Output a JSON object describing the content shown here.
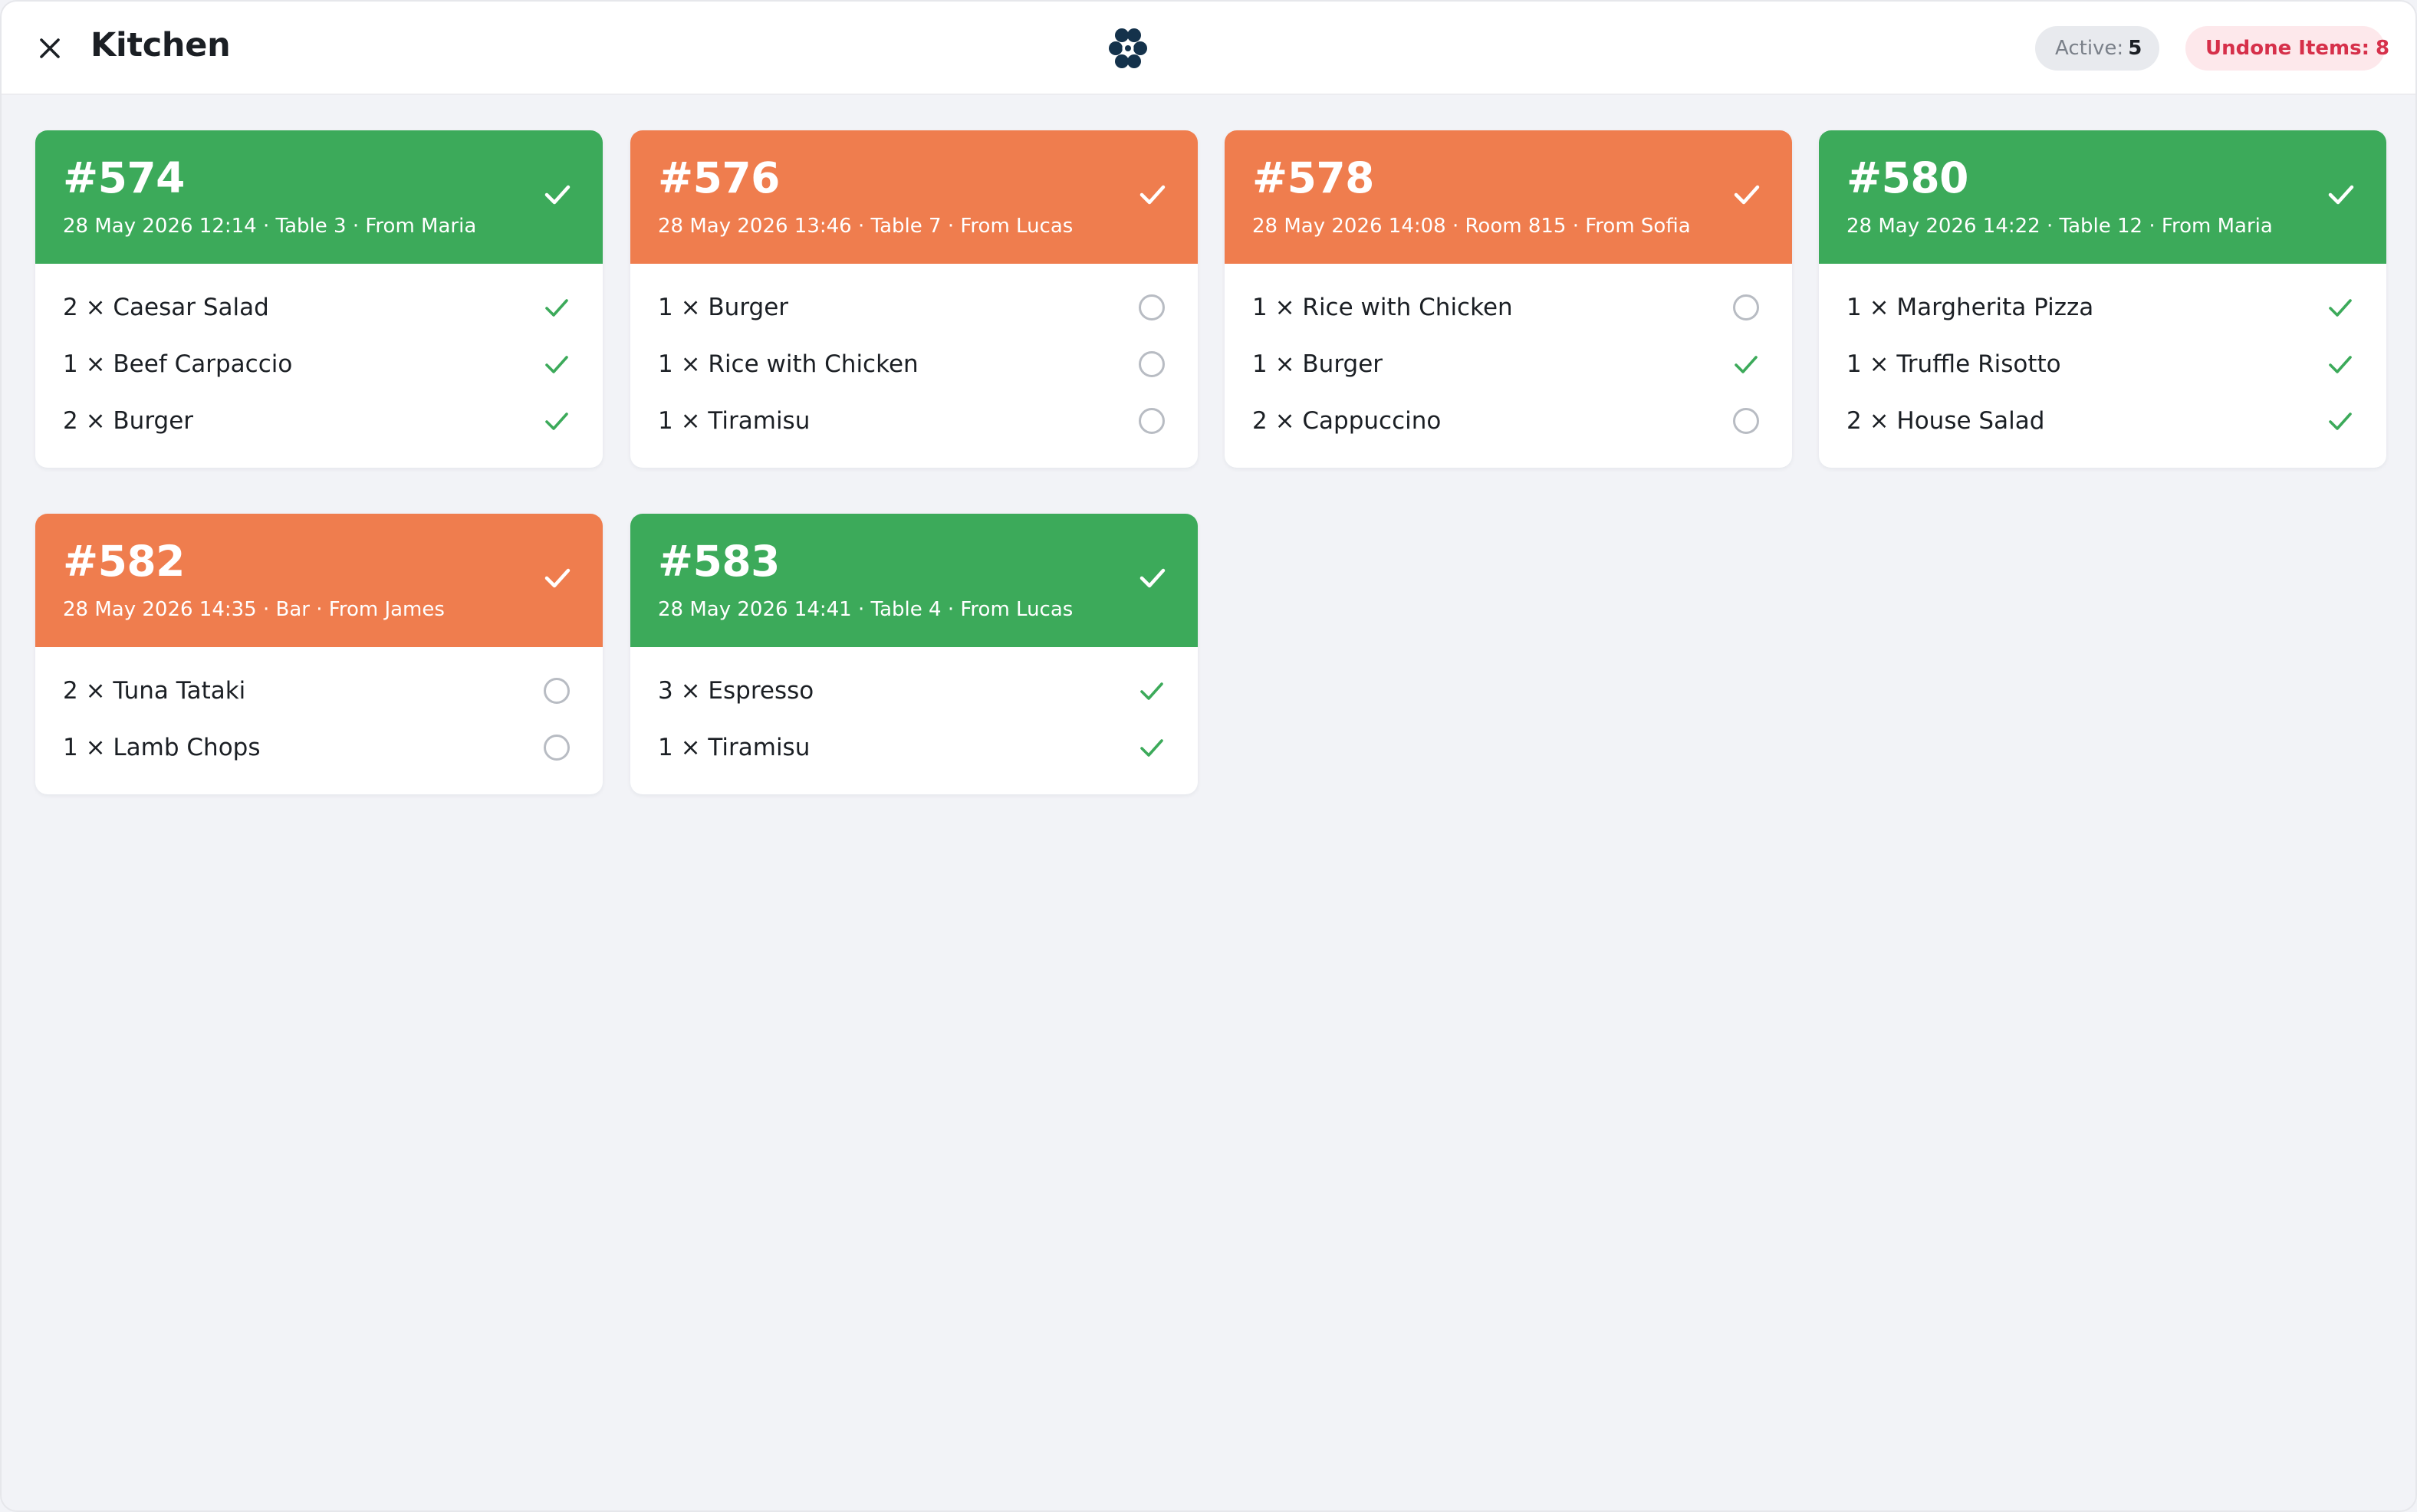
{
  "header": {
    "title": "Kitchen",
    "active_label": "Active:",
    "active_count": "5",
    "undone_label": "Undone Items:",
    "undone_count": "8"
  },
  "colors": {
    "done": "#3caa5a",
    "pending": "#ef7d4e",
    "undone_badge": "#d6304a",
    "logo": "#14324b"
  },
  "orders": [
    {
      "number": "#574",
      "status": "done",
      "meta": "28 May 2026 12:14 · Table 3 · From Maria",
      "items": [
        {
          "label": "2 × Caesar Salad",
          "done": true
        },
        {
          "label": "1 × Beef Carpaccio",
          "done": true
        },
        {
          "label": "2 × Burger",
          "done": true
        }
      ]
    },
    {
      "number": "#576",
      "status": "pending",
      "meta": "28 May 2026 13:46 · Table 7 · From Lucas",
      "items": [
        {
          "label": "1 × Burger",
          "done": false
        },
        {
          "label": "1 × Rice with Chicken",
          "done": false
        },
        {
          "label": "1 × Tiramisu",
          "done": false
        }
      ]
    },
    {
      "number": "#578",
      "status": "pending",
      "meta": "28 May 2026 14:08 · Room 815 · From Sofia",
      "items": [
        {
          "label": "1 × Rice with Chicken",
          "done": false
        },
        {
          "label": "1 × Burger",
          "done": true
        },
        {
          "label": "2 × Cappuccino",
          "done": false
        }
      ]
    },
    {
      "number": "#580",
      "status": "done",
      "meta": "28 May 2026 14:22 · Table 12 · From Maria",
      "items": [
        {
          "label": "1 × Margherita Pizza",
          "done": true
        },
        {
          "label": "1 × Truffle Risotto",
          "done": true
        },
        {
          "label": "2 × House Salad",
          "done": true
        }
      ]
    },
    {
      "number": "#582",
      "status": "pending",
      "meta": "28 May 2026 14:35 · Bar · From James",
      "items": [
        {
          "label": "2 × Tuna Tataki",
          "done": false
        },
        {
          "label": "1 × Lamb Chops",
          "done": false
        }
      ]
    },
    {
      "number": "#583",
      "status": "done",
      "meta": "28 May 2026 14:41 · Table 4 · From Lucas",
      "items": [
        {
          "label": "3 × Espresso",
          "done": true
        },
        {
          "label": "1 × Tiramisu",
          "done": true
        }
      ]
    }
  ]
}
